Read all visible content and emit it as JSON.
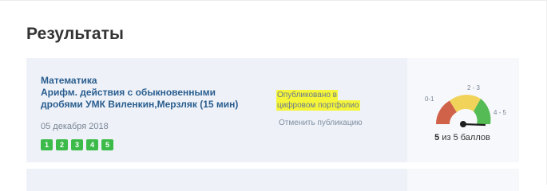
{
  "page": {
    "title": "Результаты"
  },
  "result": {
    "subject": "Математика",
    "lesson": "Арифм. действия с обыкновенными дробями УМК Виленкин,Мерзляк (15 мин)",
    "date": "05 декабря 2018",
    "scores": [
      "1",
      "2",
      "3",
      "4",
      "5"
    ],
    "published_line1": "Опубликовано в",
    "published_line2": "цифровом портфолио",
    "unpublish_label": "Отменить публикацию",
    "gauge": {
      "label_low": "0-1",
      "label_mid": "2 - 3",
      "label_high": "4 - 5",
      "score_value": "5",
      "score_suffix": " из 5 баллов",
      "score_fraction": 1.0,
      "colors": {
        "low": "#d1624a",
        "mid": "#f2d35a",
        "high": "#55bb55",
        "needle": "#1e1e1e"
      }
    }
  },
  "colors": {
    "accent": "#2a5d8f",
    "score_chip": "#3dbb4a",
    "highlight": "#f5f53a"
  }
}
